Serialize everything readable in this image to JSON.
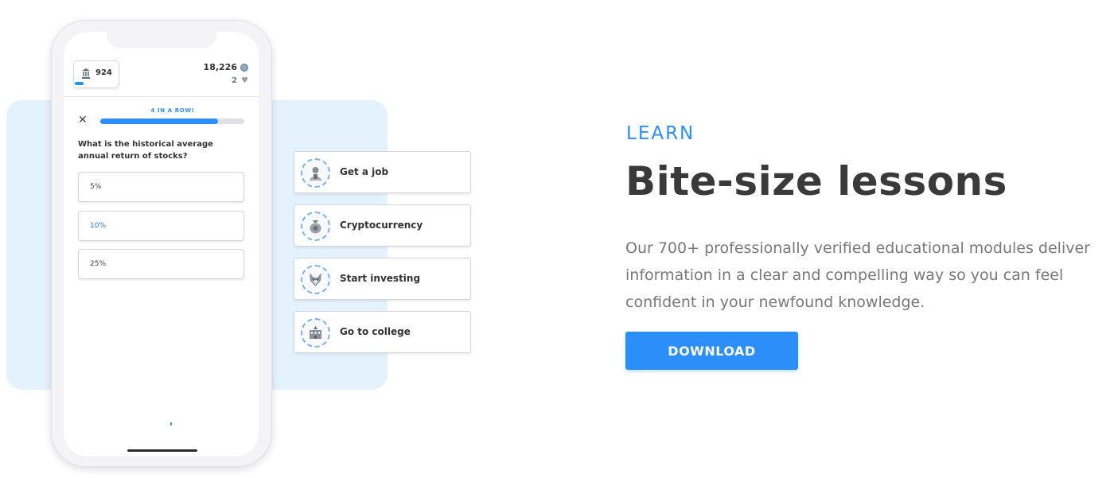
{
  "phone": {
    "streak_count": "924",
    "coins": "18,226",
    "lives": "2",
    "streak_label": "4 IN A ROW!",
    "progress_fraction": 0.82,
    "question": "What is the historical average annual return of stocks?",
    "answers": [
      {
        "label": "5%",
        "selected": false
      },
      {
        "label": "10%",
        "selected": true
      },
      {
        "label": "25%",
        "selected": false
      }
    ]
  },
  "topics": [
    {
      "label": "Get a job",
      "icon": "person-icon"
    },
    {
      "label": "Cryptocurrency",
      "icon": "money-bag-icon"
    },
    {
      "label": "Start investing",
      "icon": "fox-icon"
    },
    {
      "label": "Go to college",
      "icon": "college-building-icon"
    }
  ],
  "content": {
    "eyebrow": "LEARN",
    "headline": "Bite-size lessons",
    "description": "Our 700+ professionally verified educational modules deliver information in a clear and compelling way so you can feel confident in your newfound knowledge.",
    "download_label": "DOWNLOAD"
  },
  "colors": {
    "accent": "#2c8ef8",
    "panel_bg": "#e4f2fd",
    "heading": "#3a3a3a",
    "body_text": "#787878"
  }
}
